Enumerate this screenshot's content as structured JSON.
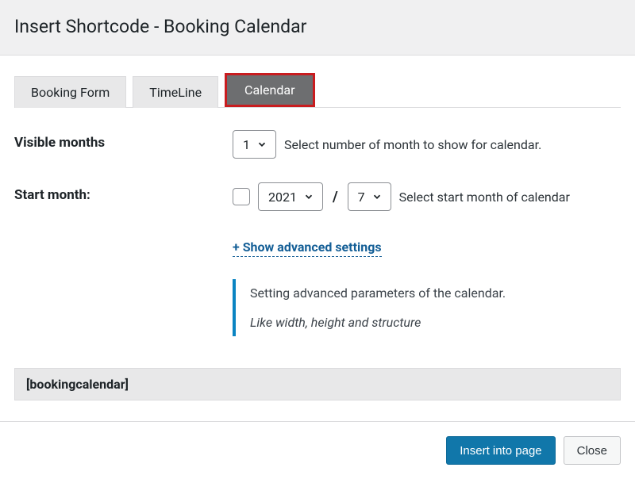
{
  "header": {
    "title": "Insert Shortcode - Booking Calendar"
  },
  "tabs": {
    "booking_form": "Booking Form",
    "timeline": "TimeLine",
    "calendar": "Calendar"
  },
  "visible_months": {
    "label": "Visible months",
    "value": "1",
    "hint": "Select number of month to show for calendar."
  },
  "start_month": {
    "label": "Start month:",
    "year": "2021",
    "month": "7",
    "separator": "/",
    "hint": "Select start month of calendar"
  },
  "advanced": {
    "link": "+ Show advanced settings",
    "desc1": "Setting advanced parameters of the calendar.",
    "desc2": "Like width, height and structure"
  },
  "shortcode": "[bookingcalendar]",
  "footer": {
    "insert": "Insert into page",
    "close": "Close"
  }
}
